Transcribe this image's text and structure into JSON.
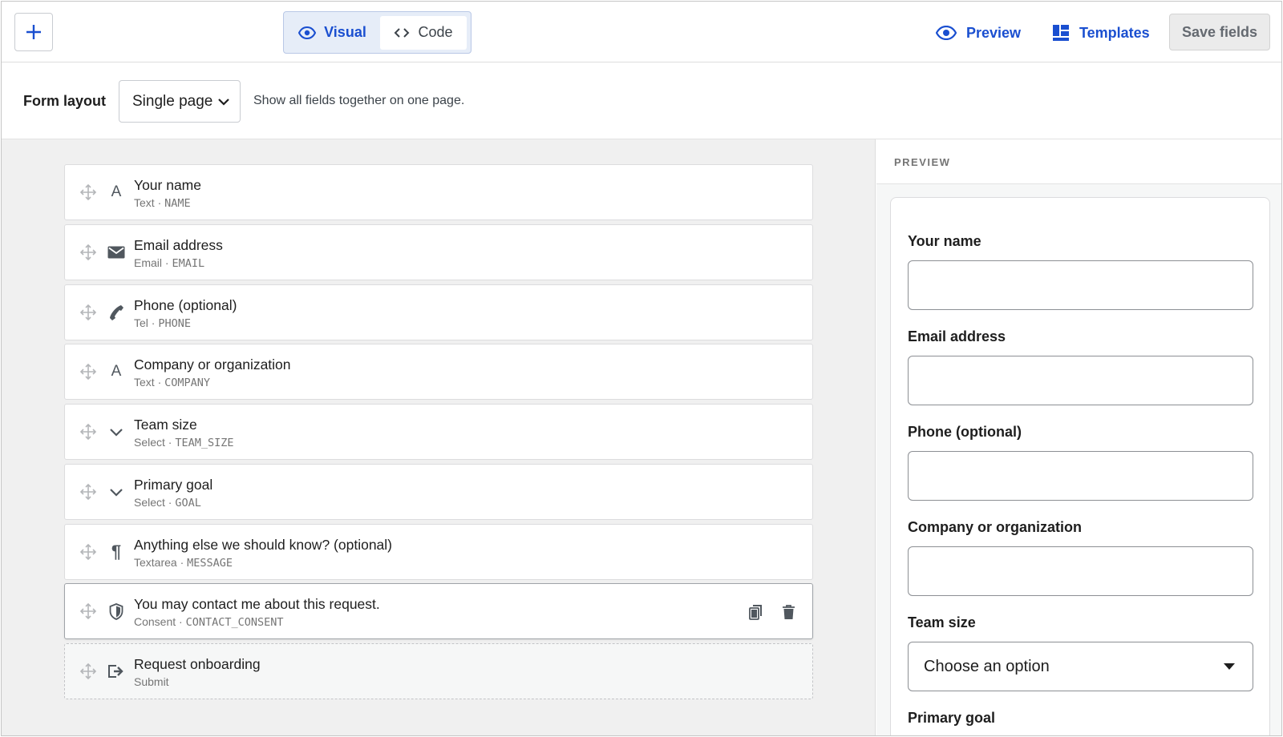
{
  "toolbar": {
    "modes": [
      {
        "label": "Visual",
        "icon": "eye-icon",
        "active": true
      },
      {
        "label": "Code",
        "icon": "code-icon",
        "active": false
      }
    ],
    "preview_label": "Preview",
    "templates_label": "Templates",
    "save_label": "Save fields",
    "accent_color": "#1a4fd0"
  },
  "layout": {
    "label": "Form layout",
    "selected": "Single page",
    "help": "Show all fields together on one page."
  },
  "fields": [
    {
      "title": "Your name",
      "type": "Text",
      "key": "NAME",
      "icon": "text-icon"
    },
    {
      "title": "Email address",
      "type": "Email",
      "key": "EMAIL",
      "icon": "envelope-icon"
    },
    {
      "title": "Phone (optional)",
      "type": "Tel",
      "key": "PHONE",
      "icon": "phone-icon"
    },
    {
      "title": "Company or organization",
      "type": "Text",
      "key": "COMPANY",
      "icon": "text-icon"
    },
    {
      "title": "Team size",
      "type": "Select",
      "key": "TEAM_SIZE",
      "icon": "chevron-down-icon"
    },
    {
      "title": "Primary goal",
      "type": "Select",
      "key": "GOAL",
      "icon": "chevron-down-icon"
    },
    {
      "title": "Anything else we should know? (optional)",
      "type": "Textarea",
      "key": "MESSAGE",
      "icon": "paragraph-icon"
    },
    {
      "title": "You may contact me about this request.",
      "type": "Consent",
      "key": "CONTACT_CONSENT",
      "icon": "shield-icon",
      "selected": true
    },
    {
      "title": "Request onboarding",
      "type": "Submit",
      "key": "",
      "icon": "submit-icon"
    }
  ],
  "preview": {
    "header": "PREVIEW",
    "fields": [
      {
        "label": "Your name",
        "kind": "input"
      },
      {
        "label": "Email address",
        "kind": "input"
      },
      {
        "label": "Phone (optional)",
        "kind": "input"
      },
      {
        "label": "Company or organization",
        "kind": "input"
      },
      {
        "label": "Team size",
        "kind": "select",
        "value": "Choose an option"
      },
      {
        "label": "Primary goal",
        "kind": "select",
        "value": ""
      }
    ]
  }
}
